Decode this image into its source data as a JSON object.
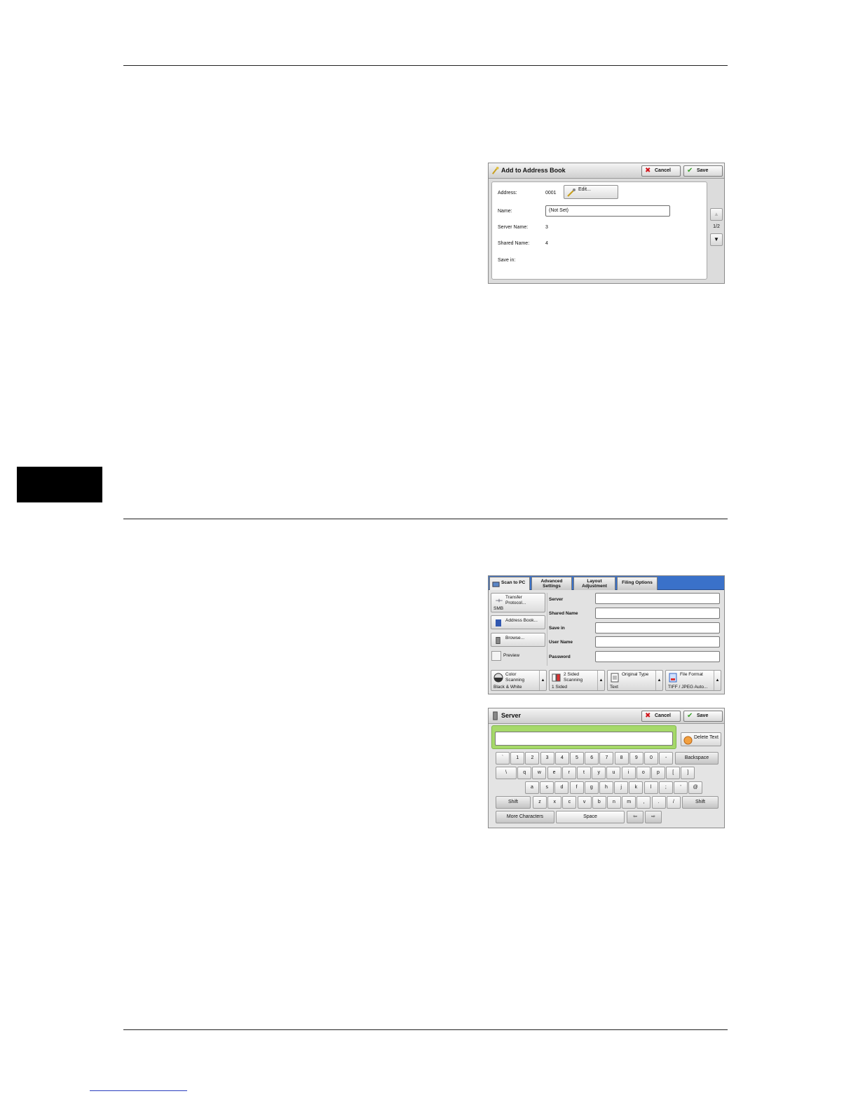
{
  "panel1": {
    "title": "Add to Address Book",
    "cancel": "Cancel",
    "save": "Save",
    "rows": [
      {
        "label": "Address:",
        "value": "0001"
      },
      {
        "label": "Name:",
        "value": "(Not Set)"
      },
      {
        "label": "Server Name:",
        "value": "3"
      },
      {
        "label": "Shared Name:",
        "value": "4"
      },
      {
        "label": "Save in:",
        "value": ""
      }
    ],
    "edit_label": "Edit...",
    "page": "1/2",
    "up_arrow": "▲",
    "down_arrow": "▼"
  },
  "panel2": {
    "tabs": [
      "Scan to PC",
      "Advanced\nSettings",
      "Layout\nAdjustment",
      "Filing Options"
    ],
    "transfer_label": "Transfer Protocol...",
    "transfer_value": "SMB",
    "address_book_label": "Address Book...",
    "browse_label": "Browse...",
    "preview_label": "Preview",
    "fields": [
      "Server",
      "Shared Name",
      "Save in",
      "User Name",
      "Password"
    ],
    "bottom": [
      {
        "label": "Color Scanning",
        "value": "Black & White"
      },
      {
        "label": "2 Sided Scanning",
        "value": "1 Sided"
      },
      {
        "label": "Original Type",
        "value": "Text"
      },
      {
        "label": "File Format",
        "value": "TIFF / JPEG Auto..."
      }
    ]
  },
  "panel3": {
    "title": "Server",
    "cancel": "Cancel",
    "save": "Save",
    "delete_text": "Delete Text",
    "row1": [
      "`",
      "1",
      "2",
      "3",
      "4",
      "5",
      "6",
      "7",
      "8",
      "9",
      "0",
      "-"
    ],
    "backspace": "Backspace",
    "row2": [
      "\\",
      "q",
      "w",
      "e",
      "r",
      "t",
      "y",
      "u",
      "i",
      "o",
      "p",
      "[",
      "]"
    ],
    "row3": [
      "a",
      "s",
      "d",
      "f",
      "g",
      "h",
      "j",
      "k",
      "l",
      ";",
      "'",
      "@"
    ],
    "shift": "Shift",
    "row4": [
      "z",
      "x",
      "c",
      "v",
      "b",
      "n",
      "m",
      ",",
      ".",
      "/"
    ],
    "more_characters": "More Characters",
    "space": "Space",
    "left_arrow": "⇦",
    "right_arrow": "⇨"
  },
  "colors": {
    "tab_bar": "#3a71c9",
    "input_highlight": "#a6d96a",
    "cancel_icon": "#d0141b",
    "save_icon": "#3aa02a"
  }
}
